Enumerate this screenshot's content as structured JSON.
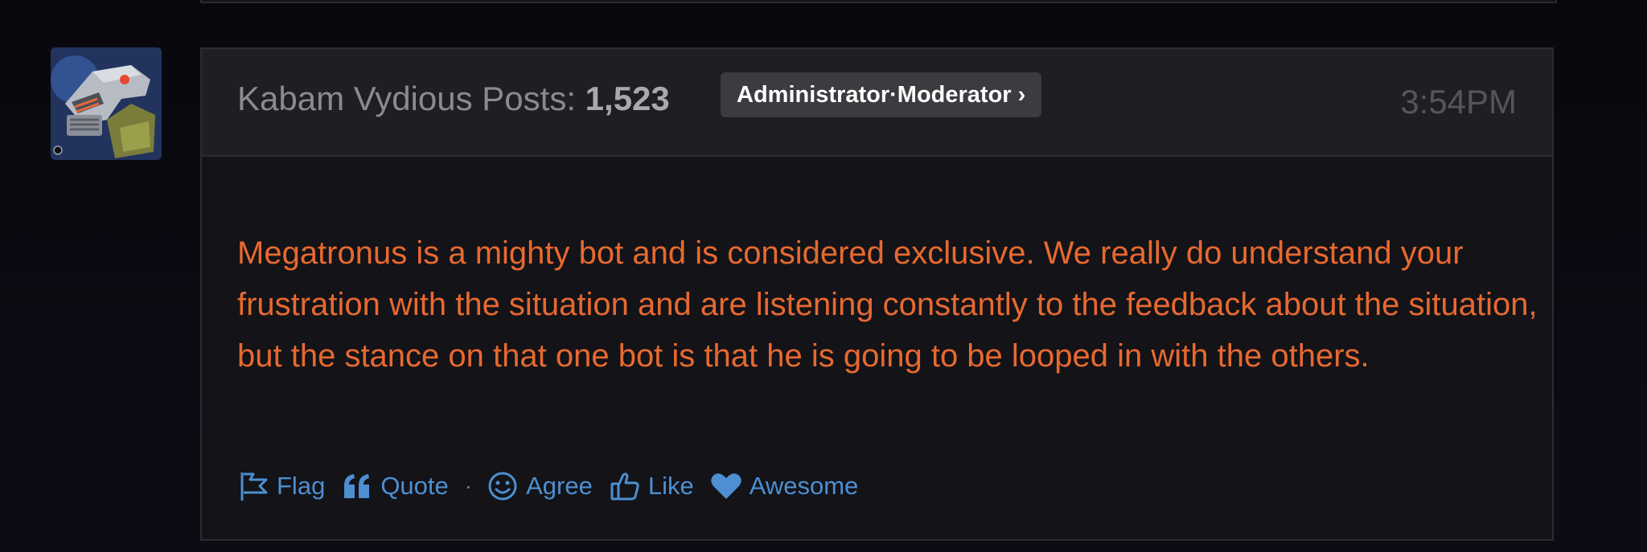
{
  "author": {
    "name": "Kabam Vydious",
    "posts_label": "Posts:",
    "posts_count": "1,523",
    "role_badge": "Administrator·Moderator ›"
  },
  "timestamp": "3:54PM",
  "body_text": "Megatronus is a mighty bot and is considered exclusive. We really do understand your frustration with the situation and are listening constantly to the feedback about the situation, but the stance on that one bot is that he is going to be looped in with the others.",
  "reactions": {
    "flag": {
      "label": "Flag",
      "icon": "flag-icon"
    },
    "quote": {
      "label": "Quote",
      "icon": "quote-icon"
    },
    "separator": "·",
    "agree": {
      "label": "Agree",
      "icon": "smiley-icon"
    },
    "like": {
      "label": "Like",
      "icon": "thumbs-up-icon"
    },
    "awesome": {
      "label": "Awesome",
      "icon": "heart-icon"
    }
  },
  "colors": {
    "page_background": "#0a0b11",
    "post_background": "#131318",
    "header_background": "#1f1f23",
    "body_text": "#e7692f",
    "reaction_link": "#4d8fd1",
    "badge_background": "#3b3b40"
  }
}
